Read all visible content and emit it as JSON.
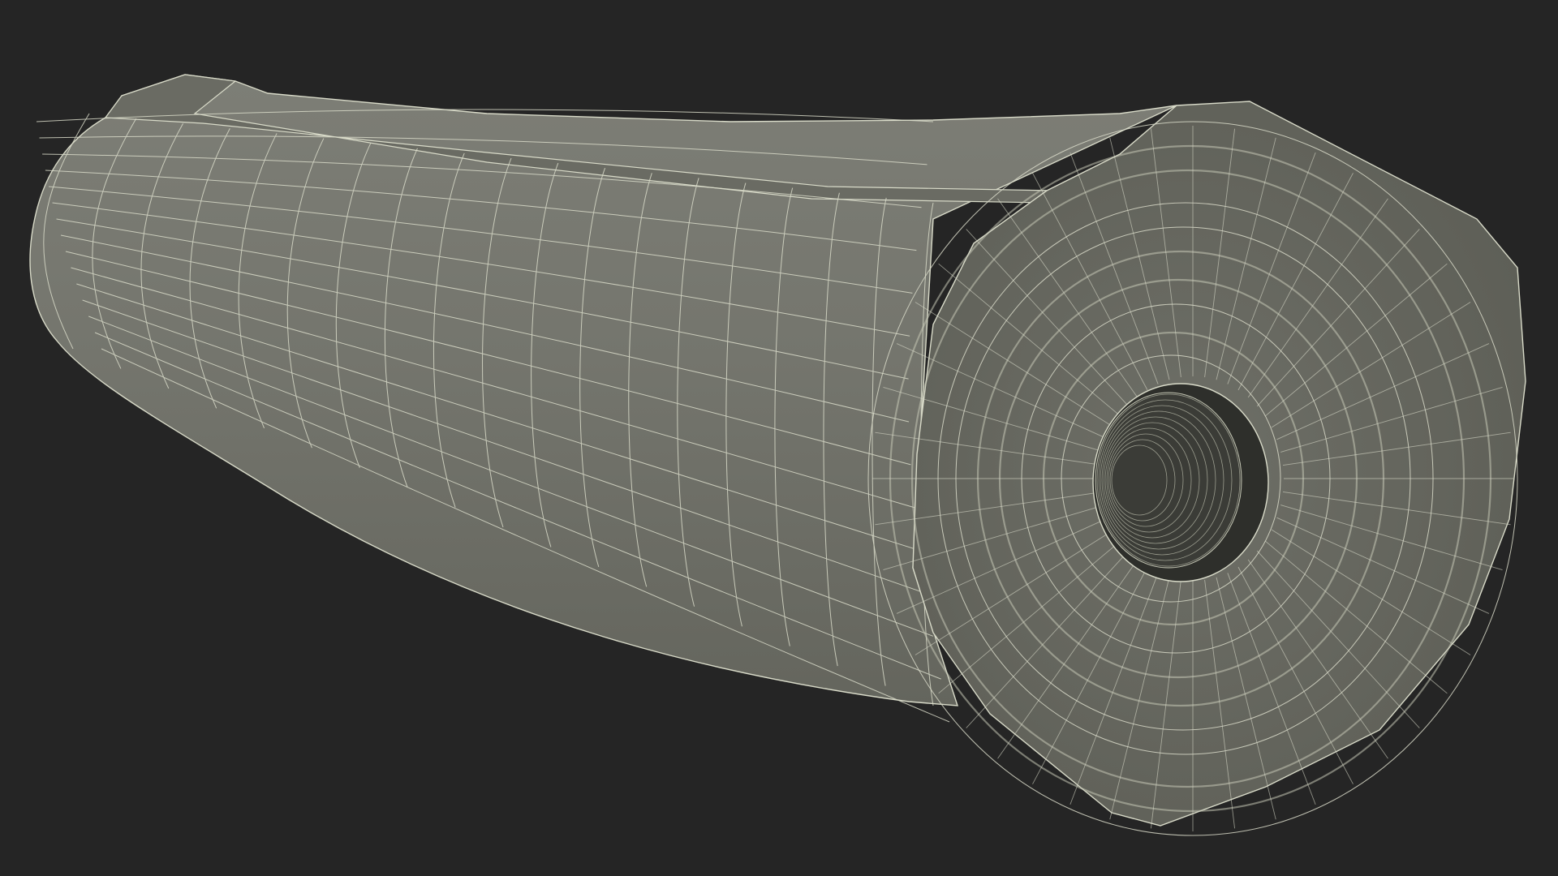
{
  "scene": {
    "subject": "rolled-mat-wireframe-render",
    "colors": {
      "background": "#252525",
      "surface": "#76776f",
      "surface_dark": "#55564f",
      "surface_shadow": "#45463f",
      "hole_interior": "#2e2f2b",
      "wire": "#d9dbc9",
      "wire_dense": "#c4c6b4"
    }
  }
}
